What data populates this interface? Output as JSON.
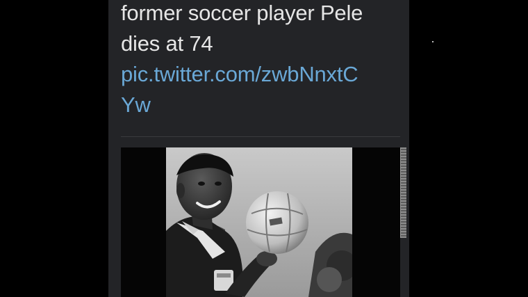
{
  "tweet": {
    "text_lines": [
      "former soccer player Pele",
      "dies at 74"
    ],
    "link_lines": [
      "pic.twitter.com/zwbNnxtC",
      "Yw"
    ]
  },
  "media": {
    "kind": "black-and-white photo",
    "subject": "man smiling holding a soccer ball"
  },
  "colors": {
    "page_background": "#000000",
    "card_background": "#232427",
    "text": "#e6e6e6",
    "link": "#6aa8d6"
  }
}
